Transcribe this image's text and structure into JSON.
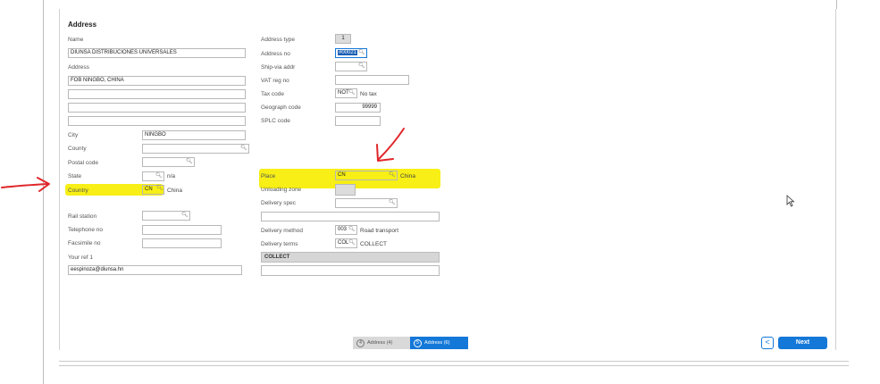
{
  "section_title": "Address",
  "left": {
    "name_label": "Name",
    "name_value": "DIUNSA DISTRIBUCIONES UNIVERSALES",
    "address_label": "Address",
    "address_line1": "FOB NINGBO, CHINA",
    "address_line2": "",
    "address_line3": "",
    "address_line4": "",
    "city_label": "City",
    "city_value": "NINGBO",
    "county_label": "County",
    "postal_label": "Postal code",
    "state_label": "State",
    "state_desc": "n/a",
    "country_label": "Country",
    "country_value": "CN",
    "country_desc": "China",
    "rail_label": "Rail station",
    "telephone_label": "Telephone no",
    "facsimile_label": "Facsimile no",
    "yourref_label": "Your ref 1",
    "yourref_value": "eespinoza@diunsa.hn"
  },
  "right": {
    "addrtype_label": "Address type",
    "addrtype_value": "1",
    "addrno_label": "Address no",
    "addrno_value": "#00021",
    "shipvia_label": "Ship-via addr",
    "vatreg_label": "VAT reg no",
    "taxcode_label": "Tax code",
    "taxcode_value": "NOT",
    "taxcode_desc": "No tax",
    "geograph_label": "Geograph code",
    "geograph_value": "99999",
    "splc_label": "SPLC code",
    "place_label": "Place",
    "place_value": "CN",
    "place_desc": "China",
    "unloading_label": "Unloading zone",
    "delspec_label": "Delivery spec",
    "delmethod_label": "Delivery method",
    "delmethod_value": "003",
    "delmethod_desc": "Road transport",
    "delterms_label": "Delivery terms",
    "delterms_value": "COL",
    "delterms_desc": "COLLECT",
    "collect_bar": "COLLECT"
  },
  "footer": {
    "step1_label": "Address (4)",
    "step1_num": "4",
    "step2_label": "Address (6)",
    "step2_num": "5",
    "back_label": "<",
    "next_label": "Next"
  },
  "icons": {
    "lookup": "magnifier-icon",
    "cursor": "mouse-cursor-icon",
    "arrow": "red-annotation-arrow"
  },
  "colors": {
    "highlight": "#f7ef15",
    "accent": "#1478d8",
    "annotation": "#e0262a"
  }
}
